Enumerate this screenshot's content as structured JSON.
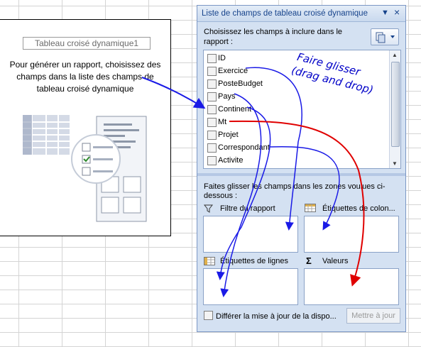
{
  "pivot": {
    "title": "Tableau croisé dynamique1",
    "message": "Pour générer un rapport, choisissez des champs dans la liste des champs de tableau croisé dynamique"
  },
  "pane": {
    "title": "Liste de champs de tableau croisé dynamique",
    "dropdown_icon": "chevron-down-icon",
    "close_label": "×",
    "instruction": "Choisissez les champs à inclure dans le rapport :",
    "fields": [
      "ID",
      "Exercice",
      "PosteBudget",
      "Pays",
      "Continent",
      "Mt",
      "Projet",
      "Correspondant",
      "Activite"
    ],
    "areas_instruction": "Faites glisser les champs dans les zones voulues ci-dessous :",
    "zones": {
      "filter": "Filtre du rapport",
      "columns": "Étiquettes de colon...",
      "rows": "Étiquettes de lignes",
      "values": "Valeurs"
    },
    "defer_label": "Différer la mise à jour de la dispo...",
    "update_button": "Mettre à jour"
  },
  "annotation": {
    "line1": "Faire glisser",
    "line2": "(drag and drop)",
    "arrow_color": "#1a1ae6",
    "highlight_arrow_color": "#e00000"
  }
}
